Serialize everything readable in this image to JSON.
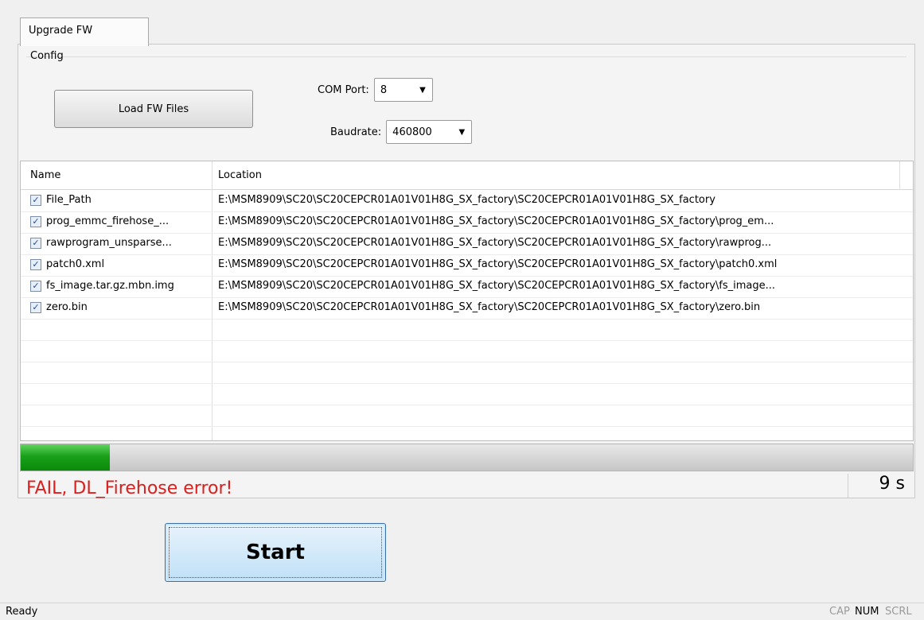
{
  "tabs": [
    {
      "label": "Upgrade FW"
    }
  ],
  "config": {
    "group_label": "Config",
    "load_button": "Load FW Files",
    "com_port": {
      "label": "COM Port:",
      "value": "8"
    },
    "baudrate": {
      "label": "Baudrate:",
      "value": "460800"
    }
  },
  "file_list": {
    "columns": [
      "Name",
      "Location"
    ],
    "rows": [
      {
        "checked": true,
        "name": "File_Path",
        "location": "E:\\MSM8909\\SC20\\SC20CEPCR01A01V01H8G_SX_factory\\SC20CEPCR01A01V01H8G_SX_factory"
      },
      {
        "checked": true,
        "name": "prog_emmc_firehose_...",
        "location": "E:\\MSM8909\\SC20\\SC20CEPCR01A01V01H8G_SX_factory\\SC20CEPCR01A01V01H8G_SX_factory\\prog_em..."
      },
      {
        "checked": true,
        "name": "rawprogram_unsparse...",
        "location": "E:\\MSM8909\\SC20\\SC20CEPCR01A01V01H8G_SX_factory\\SC20CEPCR01A01V01H8G_SX_factory\\rawprog..."
      },
      {
        "checked": true,
        "name": "patch0.xml",
        "location": "E:\\MSM8909\\SC20\\SC20CEPCR01A01V01H8G_SX_factory\\SC20CEPCR01A01V01H8G_SX_factory\\patch0.xml"
      },
      {
        "checked": true,
        "name": "fs_image.tar.gz.mbn.img",
        "location": "E:\\MSM8909\\SC20\\SC20CEPCR01A01V01H8G_SX_factory\\SC20CEPCR01A01V01H8G_SX_factory\\fs_image..."
      },
      {
        "checked": true,
        "name": "zero.bin",
        "location": "E:\\MSM8909\\SC20\\SC20CEPCR01A01V01H8G_SX_factory\\SC20CEPCR01A01V01H8G_SX_factory\\zero.bin"
      }
    ]
  },
  "progress": {
    "fraction": 0.1
  },
  "status": {
    "message": "FAIL, DL_Firehose error!",
    "elapsed": "9 s",
    "message_color": "#d9201e"
  },
  "start_button": "Start",
  "statusbar": {
    "text": "Ready",
    "indicators": [
      {
        "label": "CAP",
        "active": false
      },
      {
        "label": "NUM",
        "active": true
      },
      {
        "label": "SCRL",
        "active": false
      }
    ]
  }
}
